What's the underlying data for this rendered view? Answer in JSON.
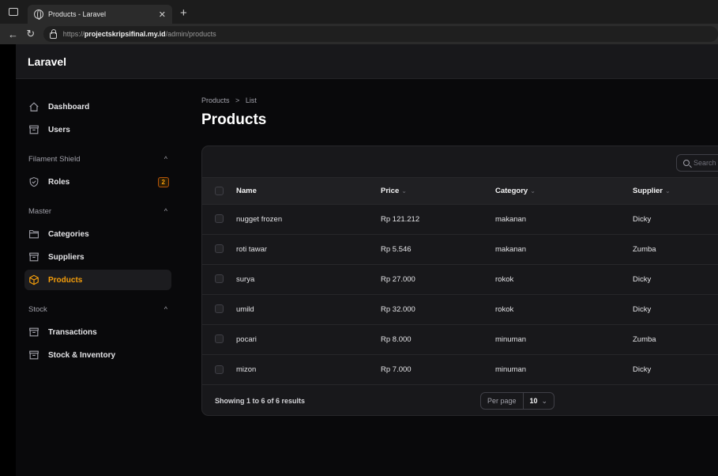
{
  "browser": {
    "tab_title": "Products - Laravel",
    "url_scheme": "https://",
    "url_host": "projectskripsifinal.my.id",
    "url_path": "/admin/products"
  },
  "app": {
    "brand": "Laravel"
  },
  "sidebar": {
    "top_items": [
      {
        "label": "Dashboard",
        "icon": "home-icon"
      },
      {
        "label": "Users",
        "icon": "box-icon"
      }
    ],
    "groups": [
      {
        "label": "Filament Shield",
        "items": [
          {
            "label": "Roles",
            "icon": "shield-check-icon",
            "badge": "2"
          }
        ]
      },
      {
        "label": "Master",
        "items": [
          {
            "label": "Categories",
            "icon": "folder-icon"
          },
          {
            "label": "Suppliers",
            "icon": "box-icon"
          },
          {
            "label": "Products",
            "icon": "cube-icon",
            "active": true
          }
        ]
      },
      {
        "label": "Stock",
        "items": [
          {
            "label": "Transactions",
            "icon": "box-icon"
          },
          {
            "label": "Stock & Inventory",
            "icon": "box-icon"
          }
        ]
      }
    ]
  },
  "breadcrumb": [
    "Products",
    "List"
  ],
  "page_title": "Products",
  "table": {
    "search_placeholder": "Search",
    "columns": [
      "Name",
      "Price",
      "Category",
      "Supplier"
    ],
    "rows": [
      {
        "name": "nugget frozen",
        "price": "Rp 121.212",
        "category": "makanan",
        "supplier": "Dicky"
      },
      {
        "name": "roti tawar",
        "price": "Rp 5.546",
        "category": "makanan",
        "supplier": "Zumba"
      },
      {
        "name": "surya",
        "price": "Rp 27.000",
        "category": "rokok",
        "supplier": "Dicky"
      },
      {
        "name": "umild",
        "price": "Rp 32.000",
        "category": "rokok",
        "supplier": "Dicky"
      },
      {
        "name": "pocari",
        "price": "Rp 8.000",
        "category": "minuman",
        "supplier": "Zumba"
      },
      {
        "name": "mizon",
        "price": "Rp 7.000",
        "category": "minuman",
        "supplier": "Dicky"
      }
    ],
    "results_text": "Showing 1 to 6 of 6 results",
    "per_page_label": "Per page",
    "per_page_value": "10"
  },
  "colors": {
    "accent": "#f59e0b",
    "background": "#09090b",
    "card": "#18181b"
  }
}
